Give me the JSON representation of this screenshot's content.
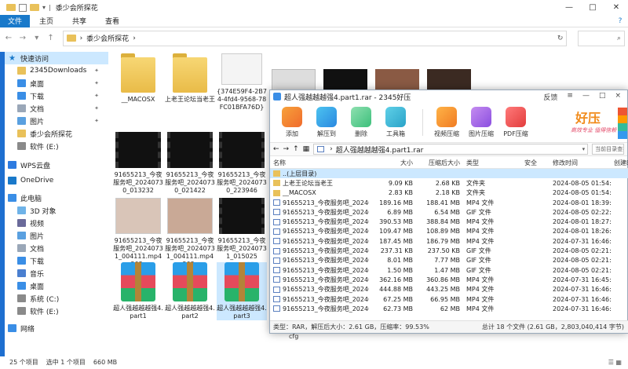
{
  "explorer": {
    "title": "黍少会所探花",
    "tabs": [
      "文件",
      "主页",
      "共享",
      "查看"
    ],
    "address_path": "黍少会所探花",
    "sidebar": [
      {
        "label": "快速访问",
        "icon": "star-icon",
        "pinned": false
      },
      {
        "label": "2345Downloads",
        "icon": "folder-icon",
        "pinned": true
      },
      {
        "label": "桌面",
        "icon": "desktop-icon",
        "pinned": true
      },
      {
        "label": "下载",
        "icon": "download-icon",
        "pinned": true
      },
      {
        "label": "文档",
        "icon": "document-icon",
        "pinned": true
      },
      {
        "label": "图片",
        "icon": "picture-icon",
        "pinned": true
      },
      {
        "label": "黍少会所探花",
        "icon": "folder-icon",
        "pinned": false
      },
      {
        "label": "软件 (E:)",
        "icon": "drive-icon",
        "pinned": false
      },
      {
        "label": "WPS云盘",
        "icon": "cloud-icon",
        "pinned": false
      },
      {
        "label": "OneDrive",
        "icon": "onedrive-icon",
        "pinned": false
      },
      {
        "label": "此电脑",
        "icon": "computer-icon",
        "pinned": false
      },
      {
        "label": "3D 对象",
        "icon": "cube-icon",
        "pinned": false
      },
      {
        "label": "视频",
        "icon": "video-icon",
        "pinned": false
      },
      {
        "label": "图片",
        "icon": "picture-icon",
        "pinned": false
      },
      {
        "label": "文档",
        "icon": "document-icon",
        "pinned": false
      },
      {
        "label": "下载",
        "icon": "download-icon",
        "pinned": false
      },
      {
        "label": "音乐",
        "icon": "music-icon",
        "pinned": false
      },
      {
        "label": "桌面",
        "icon": "desktop-icon",
        "pinned": false
      },
      {
        "label": "系统 (C:)",
        "icon": "drive-icon",
        "pinned": false
      },
      {
        "label": "软件 (E:)",
        "icon": "drive-icon",
        "pinned": false
      },
      {
        "label": "网络",
        "icon": "network-icon",
        "pinned": false
      }
    ],
    "tiles": [
      {
        "label": "__MACOSX",
        "kind": "folder"
      },
      {
        "label": "上老王论坛当老王",
        "kind": "folder"
      },
      {
        "label": "{374E59F4-2B74-4fd4-9568-78FC01BFA76D}",
        "kind": "image"
      },
      {
        "label": "91655213_今夜服务吧_20240730_013232",
        "kind": "video"
      },
      {
        "label": "91655213_今夜服务吧_20240730_021422",
        "kind": "video"
      },
      {
        "label": "91655213_今夜服务吧_20240730_223946",
        "kind": "video"
      },
      {
        "label": "91655213_今夜服务吧_20240731_004111.mp4_202...",
        "kind": "image"
      },
      {
        "label": "91655213_今夜服务吧_20240731_004111.mp4_202...",
        "kind": "image"
      },
      {
        "label": "91655213_今夜服务吧_20240731_015025",
        "kind": "video"
      },
      {
        "label": "超人强越越越强4.part1",
        "kind": "rar"
      },
      {
        "label": "超人强越越越强4.part2",
        "kind": "rar"
      },
      {
        "label": "超人强越越越强4.part3",
        "kind": "rar"
      }
    ],
    "status": {
      "count": "25 个项目",
      "selected": "选中 1 个项目",
      "size": "660 MB"
    }
  },
  "haozip": {
    "title": "超人强越越越强4.part1.rar - 2345好压",
    "title_ctrls": [
      "反馈",
      "≡",
      "—",
      "□",
      "×"
    ],
    "toolbar": [
      "添加",
      "解压到",
      "删除",
      "工具箱",
      "视频压缩",
      "图片压缩",
      "PDF压缩"
    ],
    "brand": {
      "main": "好压",
      "sub": "高效专业 值得信赖"
    },
    "path": "超人强越越越强4.part1.rar",
    "search_placeholder": "当前目录查找(支持包含查找)",
    "columns": [
      "名称",
      "大小",
      "压缩后大小",
      "类型",
      "安全",
      "修改时间",
      "创建时"
    ],
    "rows": [
      {
        "name": "..(上层目录)",
        "size": "",
        "packed": "",
        "type": "",
        "mod": "",
        "folder": true
      },
      {
        "name": "上老王论坛当老王",
        "size": "9.09 KB",
        "packed": "2.68 KB",
        "type": "文件夹",
        "mod": "2024-08-05 01:54:...",
        "folder": true
      },
      {
        "name": "__MACOSX",
        "size": "2.83 KB",
        "packed": "2.18 KB",
        "type": "文件夹",
        "mod": "2024-08-05 01:54:...",
        "folder": true
      },
      {
        "name": "91655213_今夜服务吧_20240...",
        "size": "189.16 MB",
        "packed": "188.41 MB",
        "type": "MP4 文件",
        "mod": "2024-08-01 18:39:...",
        "folder": false
      },
      {
        "name": "91655213_今夜服务吧_20240...",
        "size": "6.89 MB",
        "packed": "6.54 MB",
        "type": "GIF 文件",
        "mod": "2024-08-05 02:22:...",
        "folder": false
      },
      {
        "name": "91655213_今夜服务吧_20240...",
        "size": "390.53 MB",
        "packed": "388.84 MB",
        "type": "MP4 文件",
        "mod": "2024-08-01 18:27:...",
        "folder": false
      },
      {
        "name": "91655213_今夜服务吧_20240...",
        "size": "109.47 MB",
        "packed": "108.89 MB",
        "type": "MP4 文件",
        "mod": "2024-08-01 18:26:...",
        "folder": false
      },
      {
        "name": "91655213_今夜服务吧_20240...",
        "size": "187.45 MB",
        "packed": "186.79 MB",
        "type": "MP4 文件",
        "mod": "2024-07-31 16:46:...",
        "folder": false
      },
      {
        "name": "91655213_今夜服务吧_20240...",
        "size": "237.31 KB",
        "packed": "237.50 KB",
        "type": "GIF 文件",
        "mod": "2024-08-05 02:21:...",
        "folder": false
      },
      {
        "name": "91655213_今夜服务吧_20240...",
        "size": "8.01 MB",
        "packed": "7.77 MB",
        "type": "GIF 文件",
        "mod": "2024-08-05 02:21:...",
        "folder": false
      },
      {
        "name": "91655213_今夜服务吧_20240...",
        "size": "1.50 MB",
        "packed": "1.47 MB",
        "type": "GIF 文件",
        "mod": "2024-08-05 02:21:...",
        "folder": false
      },
      {
        "name": "91655213_今夜服务吧_20240...",
        "size": "362.16 MB",
        "packed": "360.86 MB",
        "type": "MP4 文件",
        "mod": "2024-07-31 16:45:...",
        "folder": false
      },
      {
        "name": "91655213_今夜服务吧_20240...",
        "size": "444.88 MB",
        "packed": "443.25 MB",
        "type": "MP4 文件",
        "mod": "2024-07-31 16:46:...",
        "folder": false
      },
      {
        "name": "91655213_今夜服务吧_20240...",
        "size": "67.25 MB",
        "packed": "66.95 MB",
        "type": "MP4 文件",
        "mod": "2024-07-31 16:46:...",
        "folder": false
      },
      {
        "name": "91655213_今夜服务吧_20240...",
        "size": "62.73 MB",
        "packed": "62 MB",
        "type": "MP4 文件",
        "mod": "2024-07-31 16:46:...",
        "folder": false
      }
    ],
    "status_left": "类型：RAR，解压后大小：2.61 GB，压缩率：99.53%",
    "status_right": "总计 18 个文件 (2.61 GB，2,803,040,414 字节)",
    "below_text": "cfg"
  }
}
